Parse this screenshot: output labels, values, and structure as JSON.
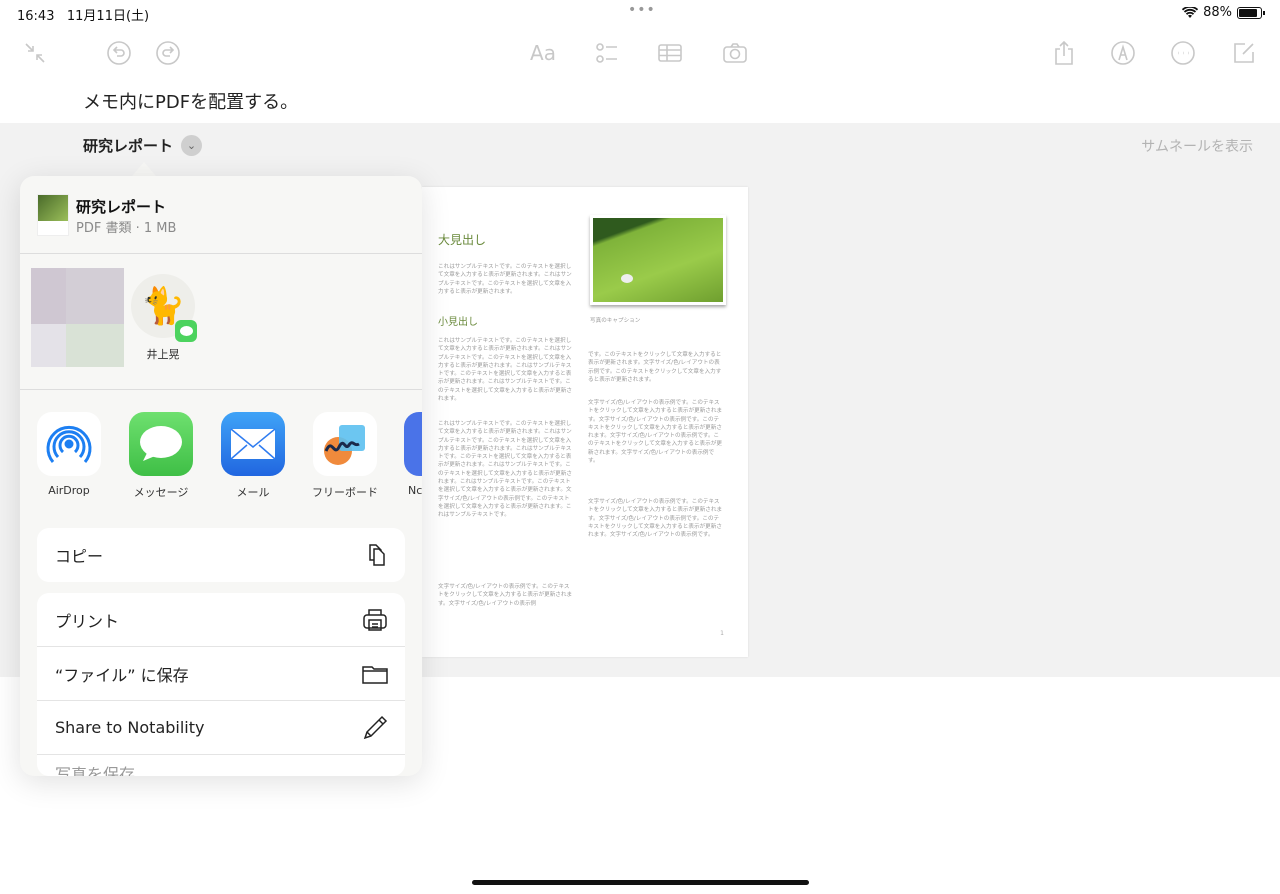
{
  "status": {
    "time": "16:43",
    "date": "11月11日(土)",
    "battery": "88%",
    "battery_level": 0.88
  },
  "toolbar": {
    "left": [
      "collapse-icon",
      "undo-icon",
      "redo-icon"
    ],
    "center": [
      "format-icon",
      "checklist-icon",
      "table-icon",
      "camera-icon"
    ],
    "right": [
      "share-icon",
      "markup-icon",
      "more-icon",
      "compose-icon"
    ],
    "format_label": "Aa"
  },
  "note": {
    "text": "メモ内にPDFを配置する。",
    "attachment_title": "研究レポート",
    "show_thumbnails": "サムネールを表示"
  },
  "pdf": {
    "heading_large": "大見出し",
    "heading_small": "小見出し",
    "caption": "写真のキャプション",
    "page_number": "1",
    "paragraphs": [
      "これはサンプルテキストです。このテキストを選択して文章を入力すると表示が更新されます。これはサンプルテキストです。このテキストを選択して文章を入力すると表示が更新されます。",
      "これはサンプルテキストです。このテキストを選択して文章を入力すると表示が更新されます。これはサンプルテキストです。このテキストを選択して文章を入力すると表示が更新されます。これはサンプルテキストです。このテキストを選択して文章を入力すると表示が更新されます。これはサンプルテキストです。このテキストを選択して文章を入力すると表示が更新されます。",
      "これはサンプルテキストです。このテキストを選択して文章を入力すると表示が更新されます。これはサンプルテキストです。このテキストを選択して文章を入力すると表示が更新されます。これはサンプルテキストです。このテキストを選択して文章を入力すると表示が更新されます。これはサンプルテキストです。このテキストを選択して文章を入力すると表示が更新されます。これはサンプルテキストです。このテキストを選択して文章を入力すると表示が更新されます。文字サイズ/色/レイアウトの表示例です。このテキストを選択して文章を入力すると表示が更新されます。これはサンプルテキストです。",
      "文字サイズ/色/レイアウトの表示例です。このテキストをクリックして文章を入力すると表示が更新されます。文字サイズ/色/レイアウトの表示例",
      "です。このテキストをクリックして文章を入力すると表示が更新されます。文字サイズ/色/レイアウトの表示例です。このテキストをクリックして文章を入力すると表示が更新されます。",
      "文字サイズ/色/レイアウトの表示例です。このテキストをクリックして文章を入力すると表示が更新されます。文字サイズ/色/レイアウトの表示例です。このテキストをクリックして文章を入力すると表示が更新されます。文字サイズ/色/レイアウトの表示例です。このテキストをクリックして文章を入力すると表示が更新されます。文字サイズ/色/レイアウトの表示例です。",
      "文字サイズ/色/レイアウトの表示例です。このテキストをクリックして文章を入力すると表示が更新されます。文字サイズ/色/レイアウトの表示例です。このテキストをクリックして文章を入力すると表示が更新されます。文字サイズ/色/レイアウトの表示例です。"
    ]
  },
  "share": {
    "title": "研究レポート",
    "subtitle": "PDF 書類 · 1 MB",
    "person": {
      "name": "井上晃",
      "avatar": "cat-icon"
    },
    "apps": [
      {
        "label": "AirDrop",
        "icon": "airdrop-icon"
      },
      {
        "label": "メッセージ",
        "icon": "messages-icon"
      },
      {
        "label": "メール",
        "icon": "mail-icon"
      },
      {
        "label": "フリーボード",
        "icon": "freeform-icon"
      },
      {
        "label": "Nc",
        "icon": "notability-icon"
      }
    ],
    "actions": [
      {
        "label": "コピー",
        "icon": "copy-icon"
      },
      {
        "label": "プリント",
        "icon": "printer-icon"
      },
      {
        "label": "“ファイル” に保存",
        "icon": "folder-icon"
      },
      {
        "label": "Share to Notability",
        "icon": "pencil-icon"
      },
      {
        "label": "写真を保存",
        "icon": "partial-icon"
      }
    ]
  },
  "colors": {
    "accent_green": "#6a8a3c",
    "messages_green": "#4cd35e",
    "mail_blue": "#2f7cf0"
  }
}
